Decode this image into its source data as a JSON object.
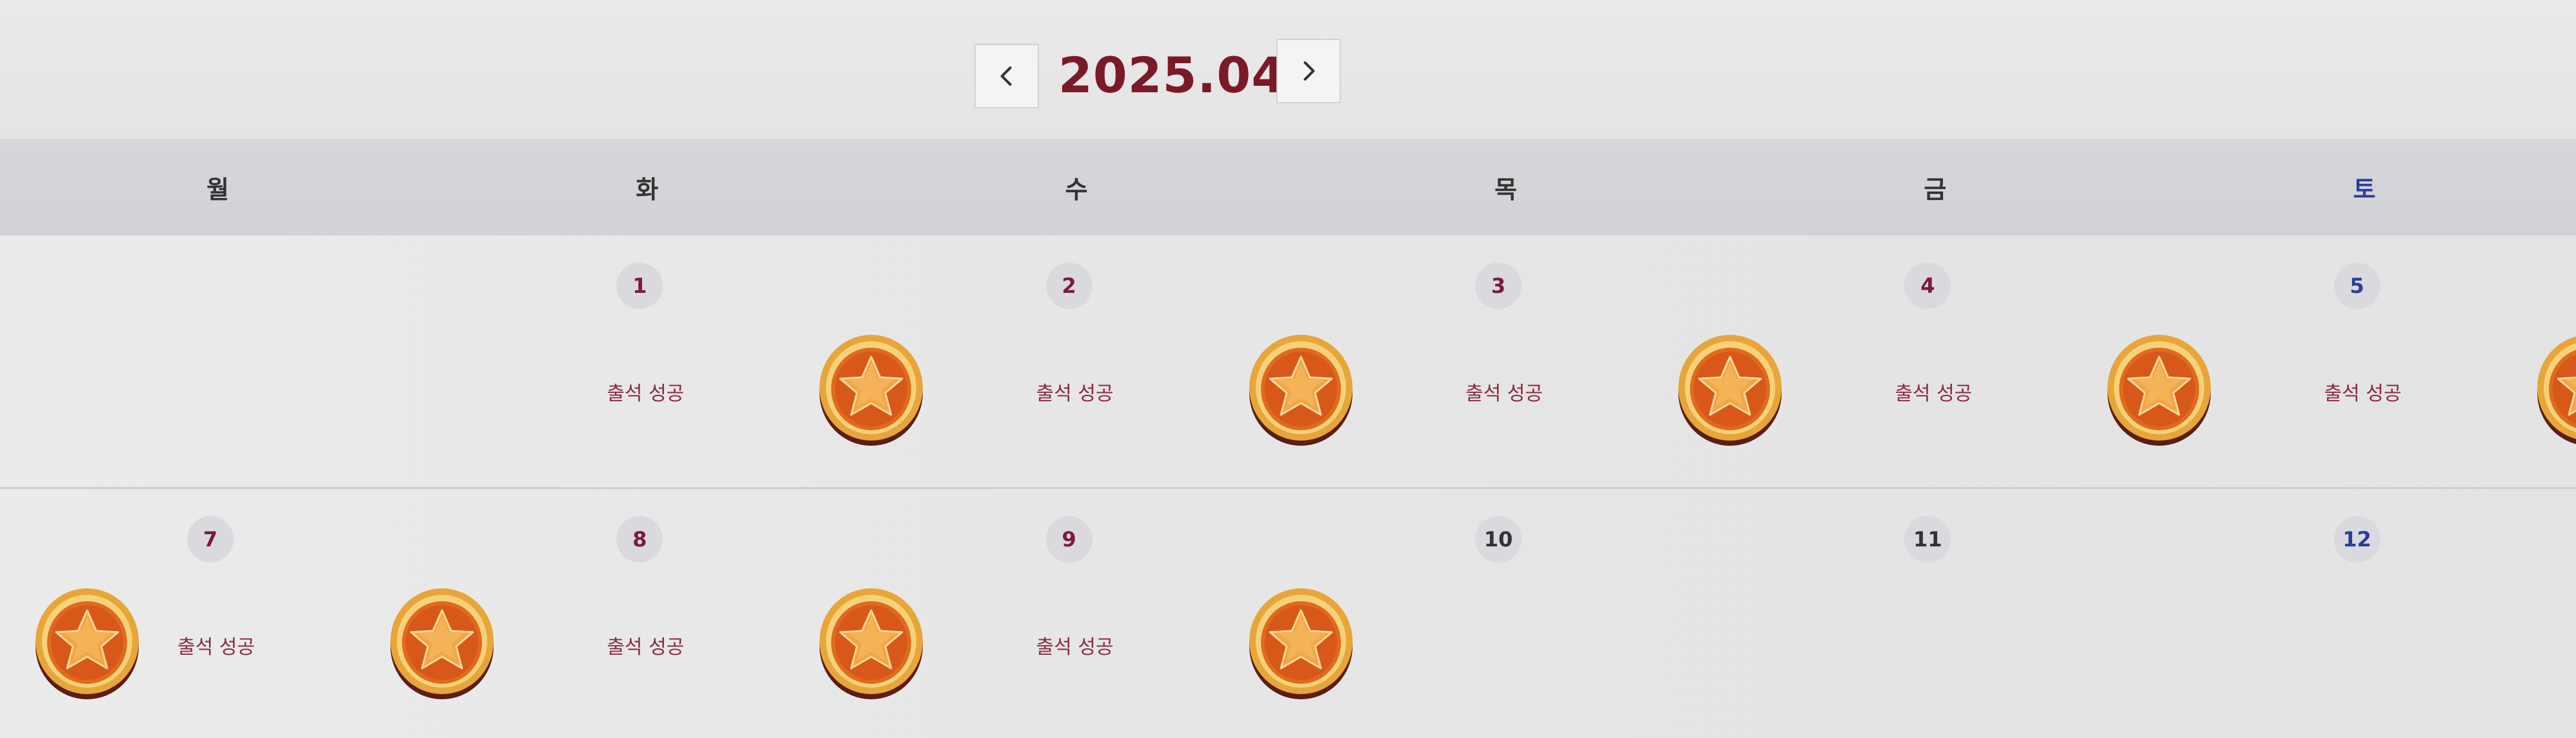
{
  "calendar": {
    "title": "2025.04",
    "prev_label": "‹",
    "next_label": "›",
    "weekdays": [
      "월",
      "화",
      "수",
      "목",
      "금",
      "토"
    ],
    "status_text": "출석 성공",
    "weeks": [
      {
        "days": [
          {
            "day": "",
            "status": "",
            "stamp": false
          },
          {
            "day": "1",
            "status": "출석 성공",
            "stamp": true
          },
          {
            "day": "2",
            "status": "출석 성공",
            "stamp": true
          },
          {
            "day": "3",
            "status": "출석 성공",
            "stamp": true
          },
          {
            "day": "4",
            "status": "출석 성공",
            "stamp": true
          },
          {
            "day": "5",
            "status": "출석 성공",
            "stamp": true
          }
        ]
      },
      {
        "days": [
          {
            "day": "7",
            "status": "출석 성공",
            "stamp": true
          },
          {
            "day": "8",
            "status": "출석 성공",
            "stamp": true
          },
          {
            "day": "9",
            "status": "출석 성공",
            "stamp": true
          },
          {
            "day": "10",
            "status": "",
            "stamp": false
          },
          {
            "day": "11",
            "status": "",
            "stamp": false
          },
          {
            "day": "12",
            "status": "",
            "stamp": false
          }
        ]
      }
    ],
    "leading_stamp_row2": true,
    "colors": {
      "title": "#7a1a28",
      "saturday": "#2a3c9c",
      "status": "#8a2a40",
      "coin_outer": "#e8a53a",
      "coin_inner": "#e06a1e",
      "star": "#f2a646"
    },
    "icons": {
      "prev": "chevron-left-icon",
      "next": "chevron-right-icon",
      "stamp": "star-coin-icon"
    }
  }
}
